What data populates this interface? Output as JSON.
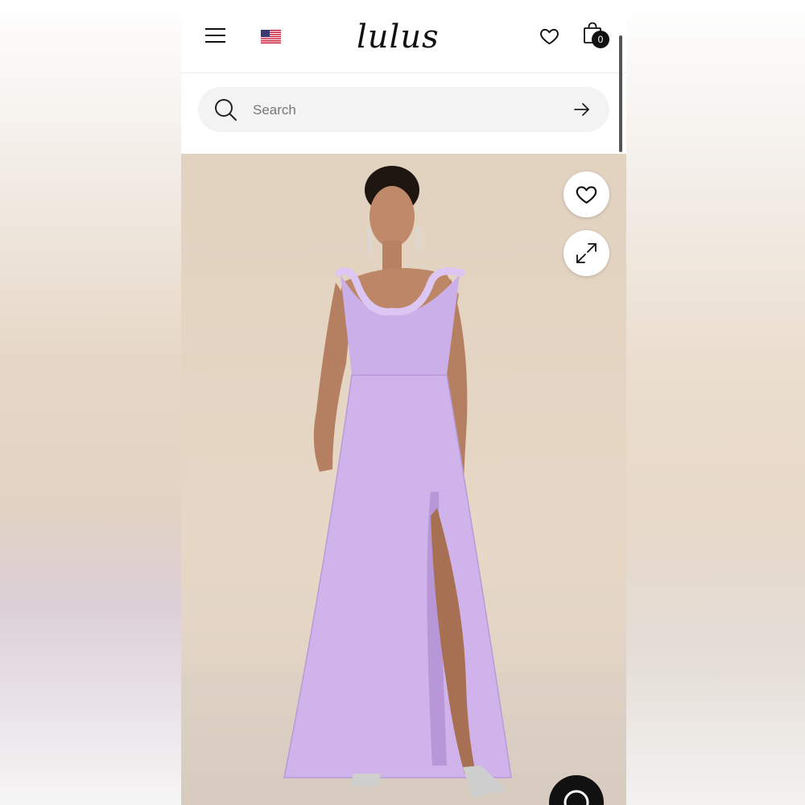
{
  "header": {
    "logo_text": "lulus",
    "cart_count": "0",
    "menu_icon": "hamburger-menu-icon",
    "flag_icon": "us-flag-icon",
    "wishlist_icon": "heart-icon",
    "cart_icon": "shopping-bag-icon"
  },
  "search": {
    "placeholder": "Search",
    "search_icon": "search-icon",
    "submit_icon": "arrow-right-icon"
  },
  "product_image": {
    "favorite_icon": "heart-icon",
    "expand_icon": "expand-icon",
    "chat_icon": "chat-bubble-icon",
    "dress_color": "#cfb3ea"
  }
}
